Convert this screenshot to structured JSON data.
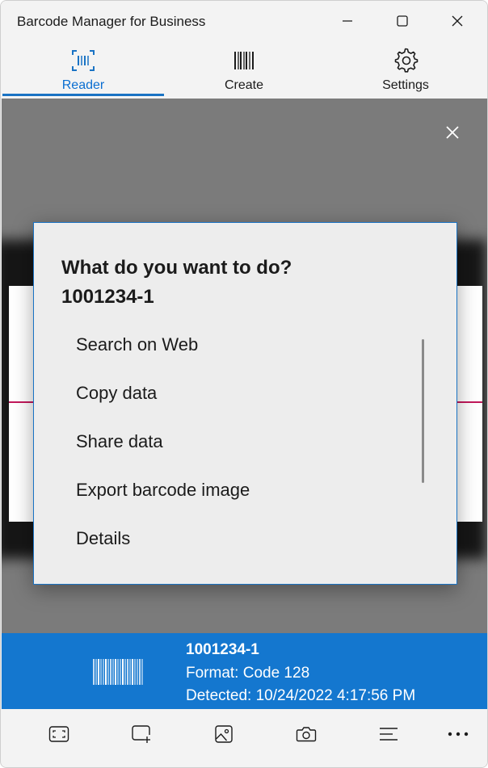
{
  "window": {
    "title": "Barcode Manager for Business"
  },
  "tabs": [
    {
      "label": "Reader",
      "icon": "barcode-scan-icon",
      "active": true
    },
    {
      "label": "Create",
      "icon": "barcode-icon",
      "active": false
    },
    {
      "label": "Settings",
      "icon": "gear-icon",
      "active": false
    }
  ],
  "dialog": {
    "title": "What do you want to do?",
    "subtitle": "1001234-1",
    "options": [
      "Search on Web",
      "Copy data",
      "Share data",
      "Export barcode image",
      "Details"
    ]
  },
  "result": {
    "code": "1001234-1",
    "format": "Format: Code 128",
    "detected": "Detected: 10/24/2022 4:17:56 PM"
  },
  "toolbar": {
    "icons": [
      "scan-area-icon",
      "add-area-icon",
      "image-icon",
      "camera-icon",
      "menu-icon",
      "more-icon"
    ]
  },
  "colors": {
    "accent": "#1477cf",
    "scan_line": "#c2185b"
  }
}
